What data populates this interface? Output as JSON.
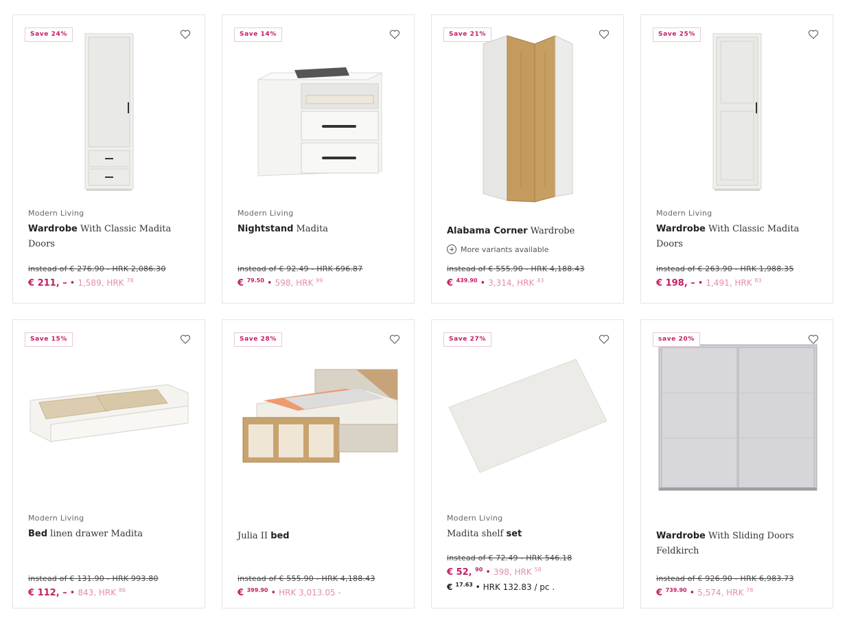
{
  "products": [
    {
      "badge": "Save 24%",
      "brand": "Modern Living",
      "title_bold": "Wardrobe",
      "title_rest": " With Classic Madita Doors",
      "old_price": "instead of € 276.90 - HRK 2,086.30",
      "eur_main": "€ 211, –",
      "eur_sup": "",
      "hrk_main": "1,589, HRK",
      "hrk_sup": "78"
    },
    {
      "badge": "Save 14%",
      "brand": "Modern Living",
      "title_bold": "Nightstand",
      "title_rest": " Madita",
      "old_price": "instead of € 92.49 - HRK 696.87",
      "eur_main": "€",
      "eur_sup": "79.50",
      "hrk_main": "598, HRK",
      "hrk_sup": "99"
    },
    {
      "badge": "Save 21%",
      "title_bold": "Alabama Corner",
      "title_rest": " Wardrobe",
      "variants": "More variants available",
      "old_price": "instead of € 555.90 - HRK 4,188.43",
      "eur_main": "€",
      "eur_sup": "439.90",
      "hrk_main": "3,314, HRK",
      "hrk_sup": "43"
    },
    {
      "badge": "Save 25%",
      "brand": "Modern Living",
      "title_bold": "Wardrobe",
      "title_rest": " With Classic Madita Doors",
      "old_price": "instead of € 263.90 - HRK 1,988.35",
      "eur_main": "€ 198, –",
      "eur_sup": "",
      "hrk_main": "1,491, HRK",
      "hrk_sup": "83"
    },
    {
      "badge": "Save 15%",
      "brand": "Modern Living",
      "title_bold": "Bed",
      "title_rest": " linen drawer Madita",
      "old_price": "instead of € 131.90 - HRK 993.80",
      "eur_main": "€ 112, –",
      "eur_sup": "",
      "hrk_main": "843, HRK",
      "hrk_sup": "86"
    },
    {
      "badge": "Save 28%",
      "title_plain": "Julia II ",
      "title_bold": "bed",
      "old_price": "instead of € 555.90 - HRK 4,188.43",
      "eur_main": "€",
      "eur_sup": "399.90",
      "hrk_main": "HRK 3,013.05 -",
      "hrk_sup": ""
    },
    {
      "badge": "Save 27%",
      "brand": "Modern Living",
      "title_plain": "Madita shelf ",
      "title_bold": "set",
      "old_price": "instead of € 72.49 - HRK 546.18",
      "eur_main": "€ 52,",
      "eur_sup": "90",
      "hrk_main": "398, HRK",
      "hrk_sup": "58",
      "unit_eur_main": "€",
      "unit_eur_sup": "17.63",
      "unit_hrk": "HRK 132.83",
      "unit_per": "/ pc ."
    },
    {
      "badge": "save 20%",
      "title_bold": "Wardrobe",
      "title_rest": " With Sliding Doors Feldkirch",
      "old_price": "instead of € 926.90 - HRK 6,983.73",
      "eur_main": "€",
      "eur_sup": "739.90",
      "hrk_main": "5,574, HRK",
      "hrk_sup": "78"
    }
  ],
  "colors": {
    "accent": "#c41d63",
    "accent_light": "#e68ab0",
    "border": "#e4e4e4"
  },
  "icons": {
    "wishlist": "heart-icon",
    "variants": "plus-circle-icon"
  }
}
